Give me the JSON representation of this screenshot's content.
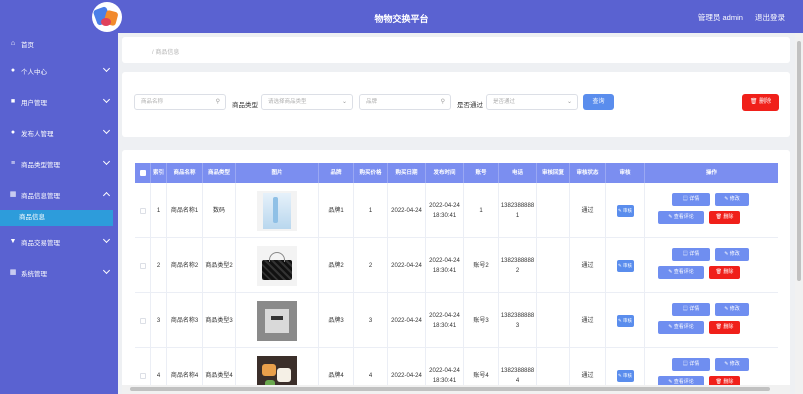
{
  "header": {
    "title": "物物交换平台",
    "user_label": "管理员 admin",
    "logout_label": "退出登录"
  },
  "sidebar": {
    "items": [
      {
        "label": "首页",
        "icon": "home-icon"
      },
      {
        "label": "个人中心",
        "icon": "user-icon"
      },
      {
        "label": "用户管理",
        "icon": "users-icon"
      },
      {
        "label": "发布人管理",
        "icon": "location-icon"
      },
      {
        "label": "商品类型管理",
        "icon": "layers-icon"
      },
      {
        "label": "商品信息管理",
        "icon": "grid-icon"
      },
      {
        "label": "商品交易管理",
        "icon": "filter-icon"
      },
      {
        "label": "系统管理",
        "icon": "grid-icon"
      }
    ],
    "active_sub": "商品信息"
  },
  "breadcrumb": "/ 商品信息",
  "search": {
    "name_placeholder": "商品名称",
    "type_label": "商品类型",
    "type_placeholder": "请选择商品类型",
    "brand_placeholder": "品牌",
    "passed_label": "是否通过",
    "passed_placeholder": "是否通过",
    "query_button": "查询",
    "delete_button": "删除"
  },
  "table": {
    "headers": [
      "索引",
      "商品名称",
      "商品类型",
      "图片",
      "品牌",
      "购买价格",
      "购买日期",
      "发布时间",
      "账号",
      "电话",
      "审核回复",
      "审核状态",
      "审核",
      "操作"
    ],
    "review_label": "审核",
    "ops": {
      "detail": "详情",
      "edit": "修改",
      "comments": "查看评论",
      "delete": "删除"
    },
    "rows": [
      {
        "index": "1",
        "name": "商品名称1",
        "type": "数码",
        "image": "skincare",
        "brand": "品牌1",
        "price": "1",
        "date": "2022-04-24",
        "published": "2022-04-24 18:30:41",
        "account": "1",
        "phone": "13823888881",
        "reply": "",
        "status": "通过"
      },
      {
        "index": "2",
        "name": "商品名称2",
        "type": "商品类型2",
        "image": "handbag",
        "brand": "品牌2",
        "price": "2",
        "date": "2022-04-24",
        "published": "2022-04-24 18:30:41",
        "account": "账号2",
        "phone": "13823888882",
        "reply": "",
        "status": "通过"
      },
      {
        "index": "3",
        "name": "商品名称3",
        "type": "商品类型3",
        "image": "device",
        "brand": "品牌3",
        "price": "3",
        "date": "2022-04-24",
        "published": "2022-04-24 18:30:41",
        "account": "账号3",
        "phone": "13823888883",
        "reply": "",
        "status": "通过"
      },
      {
        "index": "4",
        "name": "商品名称4",
        "type": "商品类型4",
        "image": "food",
        "brand": "品牌4",
        "price": "4",
        "date": "2022-04-24",
        "published": "2022-04-24 18:30:41",
        "account": "账号4",
        "phone": "13823888884",
        "reply": "",
        "status": "通过"
      }
    ]
  },
  "colors": {
    "primary": "#5a62d1",
    "accent_blue": "#6f8ef0",
    "danger": "#f0201a",
    "submenu": "#2d9cdb"
  }
}
